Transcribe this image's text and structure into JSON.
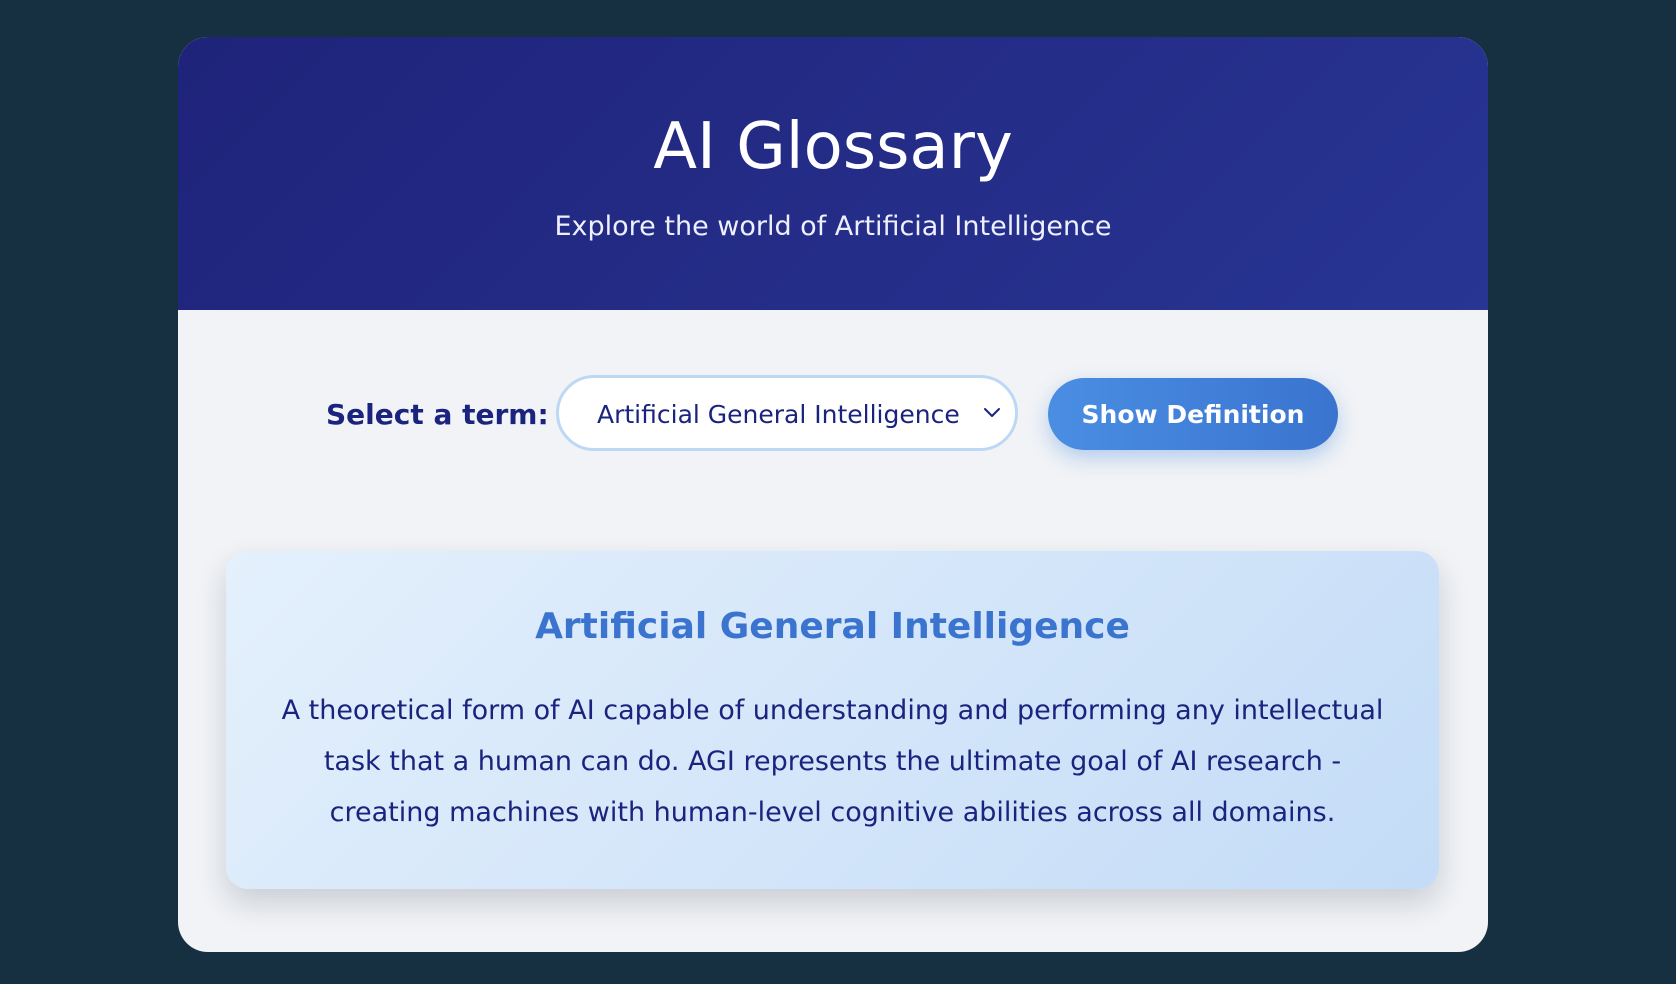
{
  "header": {
    "title": "AI Glossary",
    "subtitle": "Explore the world of Artificial Intelligence"
  },
  "controls": {
    "label": "Select a term:",
    "selected_term": "Artificial General Intelligence",
    "button_label": "Show Definition"
  },
  "definition": {
    "term": "Artificial General Intelligence",
    "text": "A theoretical form of AI capable of understanding and performing any intellectual task that a human can do. AGI represents the ultimate goal of AI research - creating machines with human-level cognitive abilities across all domains."
  },
  "icons": {
    "dropdown": "chevron-down-icon"
  },
  "colors": {
    "background": "#163042",
    "header": "#1f237a",
    "accent": "#3a74cf",
    "text_dark": "#1a237e"
  }
}
